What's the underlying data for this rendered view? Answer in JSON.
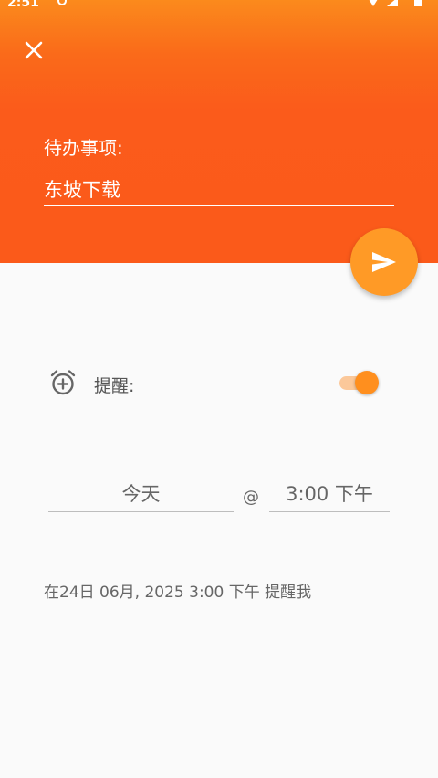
{
  "status_bar": {
    "time": "2:51"
  },
  "header": {
    "close_icon": "close-icon",
    "todo_label": "待办事项:",
    "todo_value": "东坡下载",
    "send_icon": "send-icon",
    "accent_color": "#fb5a1a"
  },
  "reminder": {
    "alarm_icon": "alarm-add-icon",
    "label": "提醒:",
    "toggle_on": true,
    "accent_color": "#ff8f1e"
  },
  "schedule": {
    "date": "今天",
    "at": "@",
    "time": "3:00 下午"
  },
  "summary": "在24日 06月, 2025 3:00 下午 提醒我"
}
